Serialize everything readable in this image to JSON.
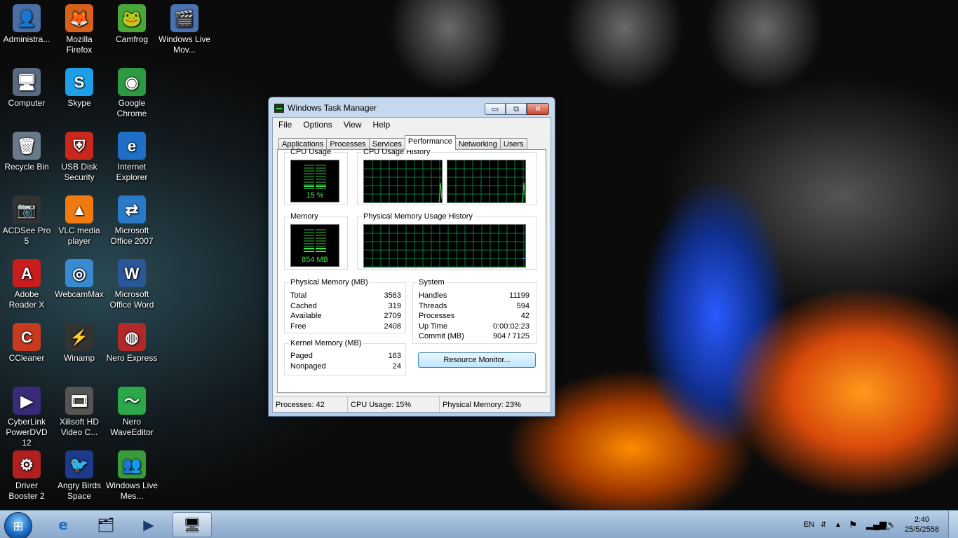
{
  "desktop": {
    "icons": [
      {
        "label": "Administra...",
        "symbol": "👤",
        "bg": "#4a6fa5"
      },
      {
        "label": "Mozilla Firefox",
        "symbol": "🦊",
        "bg": "#d8621b"
      },
      {
        "label": "Camfrog",
        "symbol": "🐸",
        "bg": "#4aa83a"
      },
      {
        "label": "Windows Live Mov...",
        "symbol": "🎬",
        "bg": "#4a72b0"
      },
      {
        "label": "Computer",
        "symbol": "🖥",
        "bg": "#5a6a80"
      },
      {
        "label": "Skype",
        "symbol": "S",
        "bg": "#1ea0e8"
      },
      {
        "label": "Google Chrome",
        "symbol": "◉",
        "bg": "#2d9a43"
      },
      {
        "label": "Recycle Bin",
        "symbol": "🗑",
        "bg": "#6a7a8a"
      },
      {
        "label": "USB Disk Security",
        "symbol": "⛨",
        "bg": "#c8281e"
      },
      {
        "label": "Internet Explorer",
        "symbol": "e",
        "bg": "#1f6fc7"
      },
      {
        "label": "ACDSee Pro 5",
        "symbol": "📷",
        "bg": "#333"
      },
      {
        "label": "VLC media player",
        "symbol": "▲",
        "bg": "#f07a10"
      },
      {
        "label": "Microsoft Office 2007",
        "symbol": "⇄",
        "bg": "#2a7ac8"
      },
      {
        "label": "Adobe Reader X",
        "symbol": "A",
        "bg": "#c81e1e"
      },
      {
        "label": "WebcamMax",
        "symbol": "◎",
        "bg": "#3a8ad0"
      },
      {
        "label": "Microsoft Office Word",
        "symbol": "W",
        "bg": "#2b5797"
      },
      {
        "label": "CCleaner",
        "symbol": "C",
        "bg": "#c83a1e"
      },
      {
        "label": "Winamp",
        "symbol": "⚡",
        "bg": "#333"
      },
      {
        "label": "Nero Express",
        "symbol": "◍",
        "bg": "#b02a2a"
      },
      {
        "label": "CyberLink PowerDVD 12",
        "symbol": "▶",
        "bg": "#3a2a7a"
      },
      {
        "label": "Xilisoft HD Video C...",
        "symbol": "🎞",
        "bg": "#555"
      },
      {
        "label": "Nero WaveEditor",
        "symbol": "〜",
        "bg": "#2aa84a"
      },
      {
        "label": "Driver Booster 2",
        "symbol": "⚙",
        "bg": "#b02020"
      },
      {
        "label": "Angry Birds Space",
        "symbol": "🐦",
        "bg": "#1e3a8a"
      },
      {
        "label": "Windows Live Mes...",
        "symbol": "👥",
        "bg": "#3a9a3a"
      }
    ]
  },
  "task_manager": {
    "title": "Windows Task Manager",
    "caption_buttons": {
      "minimize": "▭",
      "restore": "⧉",
      "close": "✕"
    },
    "menu": [
      "File",
      "Options",
      "View",
      "Help"
    ],
    "tabs": [
      "Applications",
      "Processes",
      "Services",
      "Performance",
      "Networking",
      "Users"
    ],
    "active_tab": "Performance",
    "cpu_usage": {
      "label": "CPU Usage",
      "value_text": "15 %",
      "level": 0.15
    },
    "cpu_history": {
      "label": "CPU Usage History"
    },
    "memory": {
      "label": "Memory",
      "value_text": "854 MB",
      "level": 0.24
    },
    "mem_history": {
      "label": "Physical Memory Usage History"
    },
    "physical_memory": {
      "label": "Physical Memory (MB)",
      "rows": [
        {
          "k": "Total",
          "v": "3563"
        },
        {
          "k": "Cached",
          "v": "319"
        },
        {
          "k": "Available",
          "v": "2709"
        },
        {
          "k": "Free",
          "v": "2408"
        }
      ]
    },
    "kernel_memory": {
      "label": "Kernel Memory (MB)",
      "rows": [
        {
          "k": "Paged",
          "v": "163"
        },
        {
          "k": "Nonpaged",
          "v": "24"
        }
      ]
    },
    "system": {
      "label": "System",
      "rows": [
        {
          "k": "Handles",
          "v": "11199"
        },
        {
          "k": "Threads",
          "v": "594"
        },
        {
          "k": "Processes",
          "v": "42"
        },
        {
          "k": "Up Time",
          "v": "0:00:02:23"
        },
        {
          "k": "Commit (MB)",
          "v": "904 / 7125"
        }
      ]
    },
    "resource_monitor_button": "Resource Monitor...",
    "status": {
      "processes": "Processes: 42",
      "cpu": "CPU Usage: 15%",
      "memory": "Physical Memory: 23%"
    }
  },
  "taskbar": {
    "start_symbol": "⊞",
    "pinned": [
      {
        "name": "internet-explorer",
        "symbol": "e"
      },
      {
        "name": "windows-explorer",
        "symbol": "🗂"
      },
      {
        "name": "media-player",
        "symbol": "▶"
      },
      {
        "name": "task-manager",
        "symbol": "🖥"
      }
    ],
    "tray": {
      "language": "EN",
      "time": "2:40",
      "date": "25/5/2558"
    }
  }
}
